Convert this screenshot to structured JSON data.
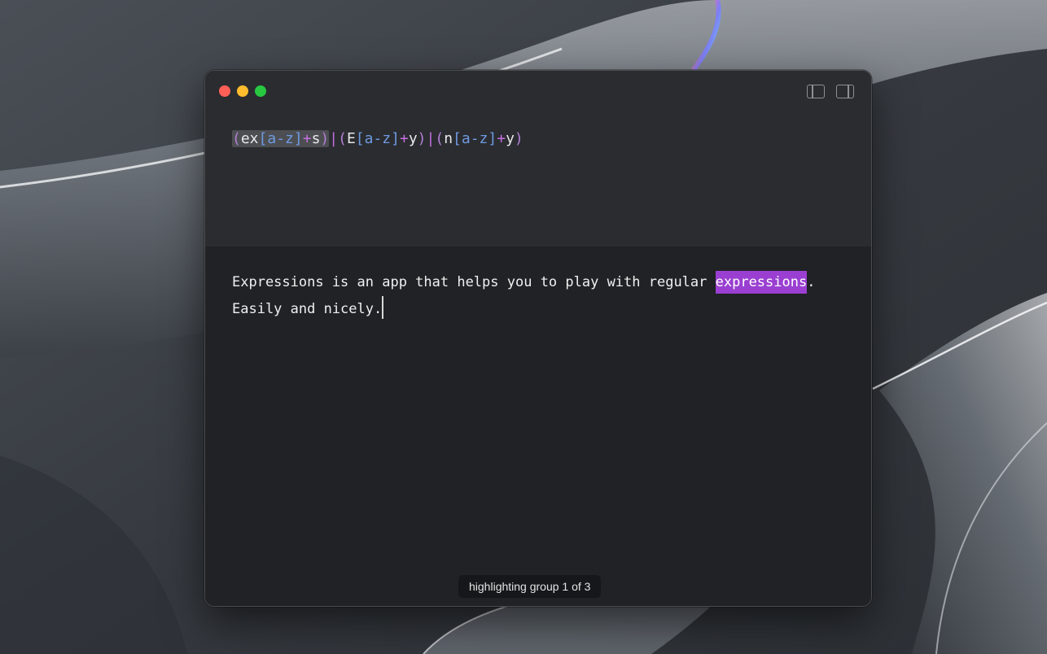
{
  "window": {
    "buttons": {
      "close": "close-button",
      "minimize": "minimize-button",
      "zoom": "zoom-button"
    },
    "toolbar": {
      "left_toggle_icon": "sidebar-left-icon",
      "right_toggle_icon": "sidebar-right-icon"
    }
  },
  "regex": {
    "group1": {
      "open": "(",
      "lit": "ex",
      "cls": "[a-z]",
      "op": "+",
      "lit2": "s",
      "close": ")"
    },
    "sep1": "|",
    "group2": {
      "open": "(",
      "lit": "E",
      "cls": "[a-z]",
      "op": "+",
      "lit2": "y",
      "close": ")"
    },
    "sep2": "|",
    "group3": {
      "open": "(",
      "lit": "n",
      "cls": "[a-z]",
      "op": "+",
      "lit2": "y",
      "close": ")"
    }
  },
  "sample": {
    "line1_before": "Expressions is an app that helps you to play with regular ",
    "match": "expressions",
    "line1_after": ".",
    "line2": "Easily and nicely."
  },
  "status": {
    "text": "highlighting group 1 of 3"
  },
  "colors": {
    "match_highlight": "#9a3fd1",
    "regex_class": "#6f9ae0",
    "regex_operator": "#c56ee0",
    "close": "#fe5f57",
    "minimize": "#febc2e",
    "zoom": "#28c840"
  }
}
